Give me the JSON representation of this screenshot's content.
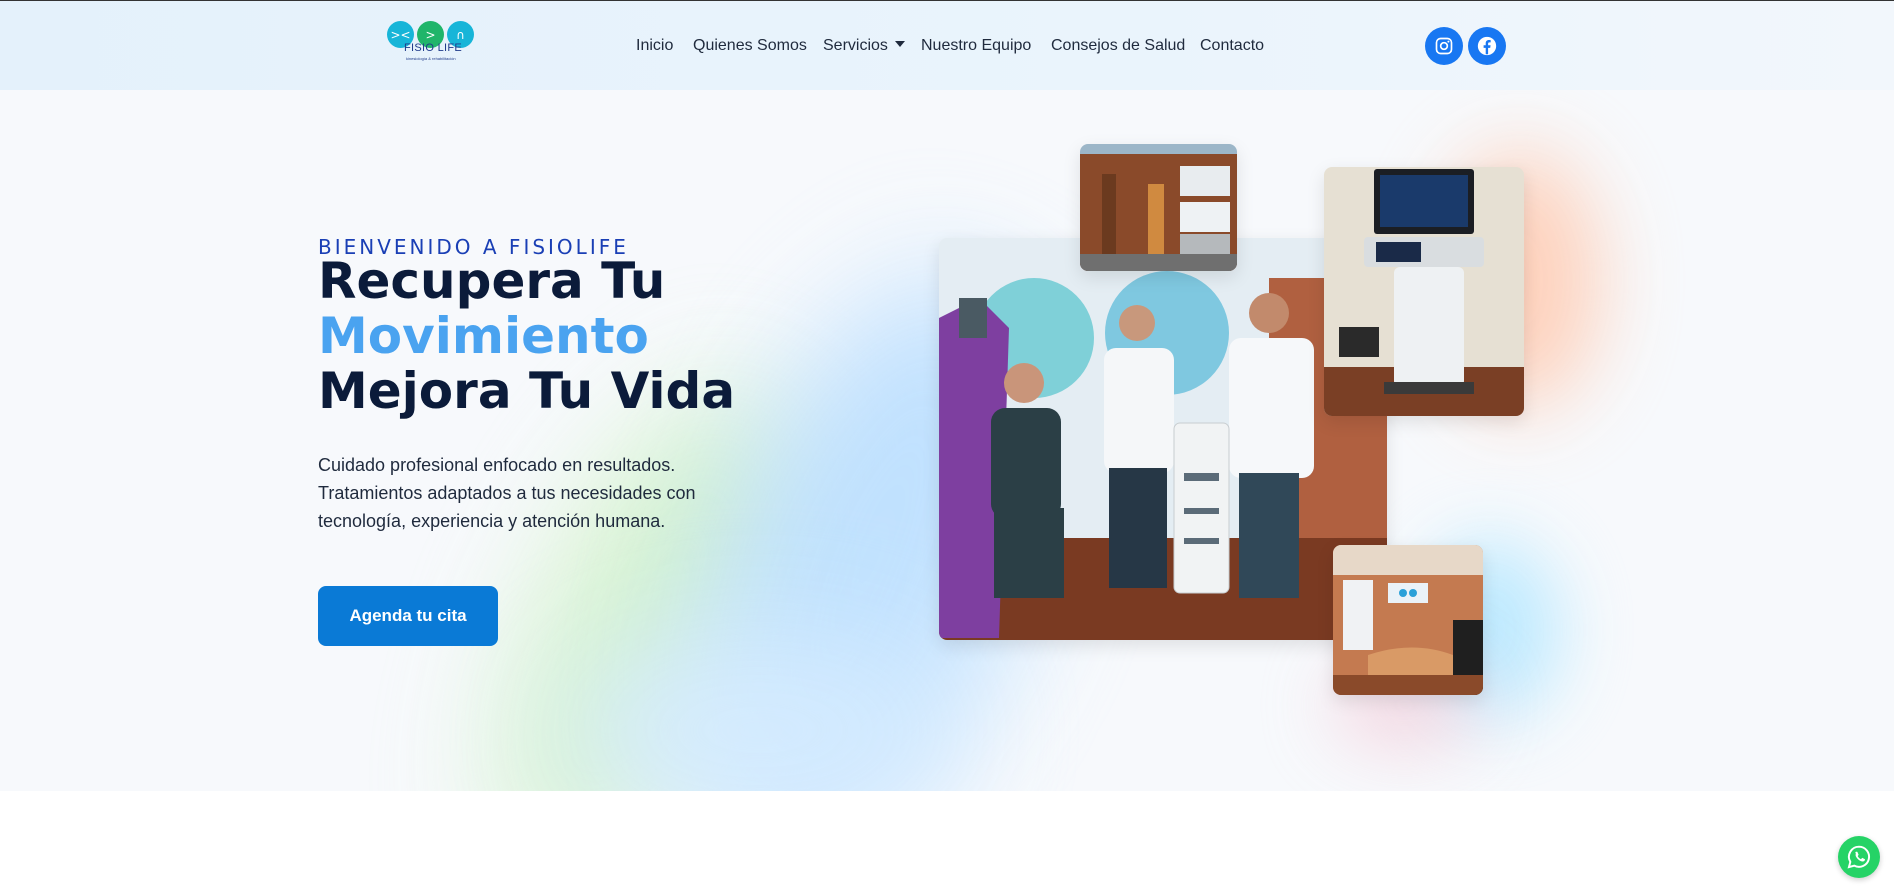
{
  "brand": {
    "logo_text": "FISIO LIFE",
    "logo_subtext": "kinesiología & rehabilitación"
  },
  "nav": {
    "items": [
      {
        "label": "Inicio"
      },
      {
        "label": "Quienes Somos"
      },
      {
        "label": "Servicios"
      },
      {
        "label": "Nuestro Equipo"
      },
      {
        "label": "Consejos de Salud"
      },
      {
        "label": "Contacto"
      }
    ]
  },
  "social": {
    "instagram_icon": "instagram-icon",
    "facebook_icon": "facebook-icon",
    "color": "#1877f2"
  },
  "hero": {
    "eyebrow": "BIENVENIDO A FISIOLIFE",
    "title_line1": "Recupera Tu",
    "title_line2": "Movimiento",
    "title_line3": "Mejora Tu Vida",
    "description": "Cuidado profesional enfocado en resultados. Tratamientos adaptados a tus necesidades con tecnología, experiencia y atención humana.",
    "cta_label": "Agenda tu cita",
    "accent_color": "#4aa3f0",
    "cta_color": "#0a7ad6"
  },
  "floating": {
    "whatsapp_icon": "whatsapp-icon"
  }
}
